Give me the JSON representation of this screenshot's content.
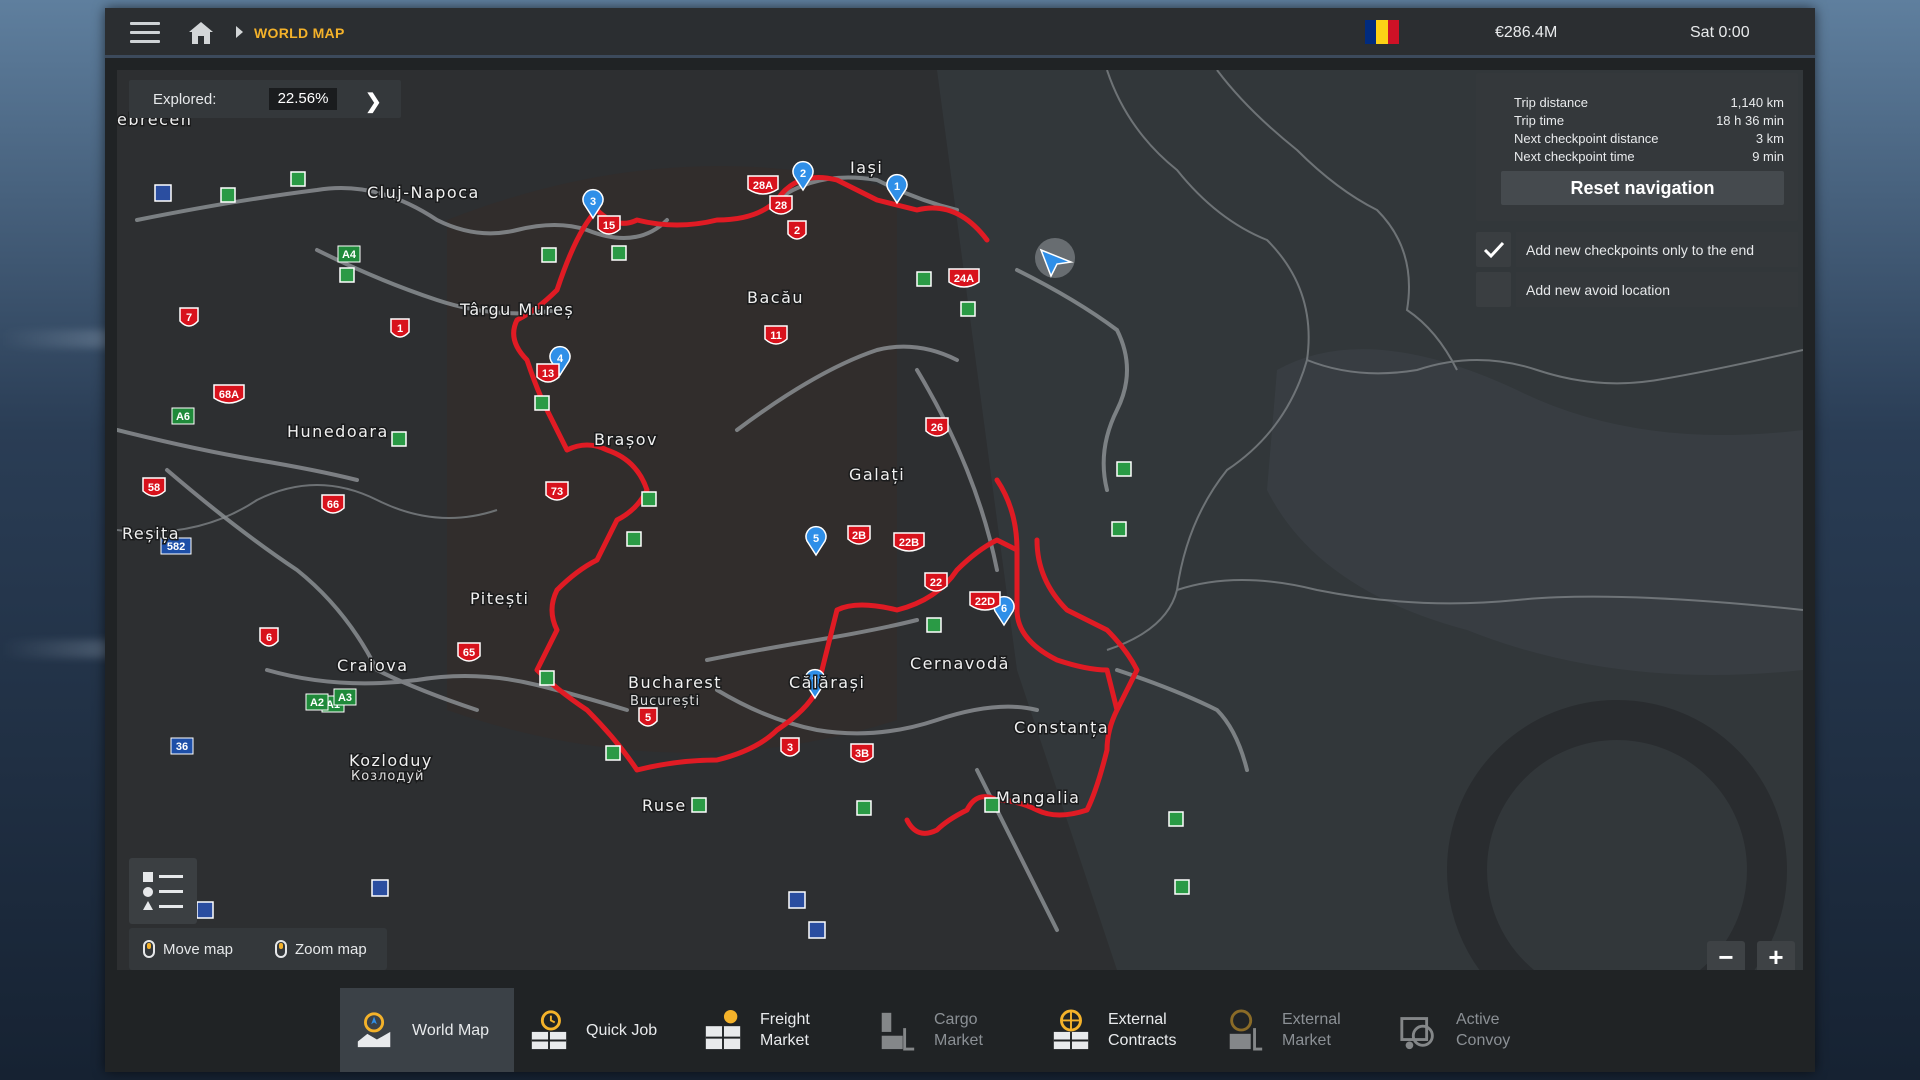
{
  "topbar": {
    "breadcrumb": "WORLD MAP",
    "money": "€286.4M",
    "time": "Sat 0:00",
    "flag_colors": [
      "#002b7f",
      "#fcd116",
      "#ce1126"
    ]
  },
  "map": {
    "explored_label": "Explored:",
    "explored_value": "22.56%",
    "cities": [
      {
        "name": "ebrecen"
      },
      {
        "name": "Cluj-Napoca"
      },
      {
        "name": "Iași"
      },
      {
        "name": "Târgu Mureș"
      },
      {
        "name": "Bacău"
      },
      {
        "name": "Hunedoara"
      },
      {
        "name": "Brașov"
      },
      {
        "name": "Galați"
      },
      {
        "name": "Reșița"
      },
      {
        "name": "Pitești"
      },
      {
        "name": "Craiova"
      },
      {
        "name": "Bucharest"
      },
      {
        "name": "Călărași"
      },
      {
        "name": "Cernavodă"
      },
      {
        "name": "Constanța"
      },
      {
        "name": "Kozloduy"
      },
      {
        "name": "Mangalia"
      },
      {
        "name": "Ruse"
      }
    ],
    "city_subtitles": {
      "bucharest": "București",
      "kozloduy": "Козлодуй"
    },
    "route_color": "#e01b24",
    "checkpoints": [
      "1",
      "2",
      "3",
      "4",
      "5",
      "6",
      "7"
    ],
    "road_numbers": [
      "28A",
      "28",
      "2",
      "15",
      "24A",
      "11",
      "13",
      "73",
      "26",
      "2B",
      "22B",
      "22",
      "22D",
      "5",
      "3",
      "3B",
      "7",
      "1",
      "68A",
      "58",
      "66",
      "6",
      "65",
      "A1",
      "A2",
      "A3",
      "A4",
      "A6",
      "582",
      "36"
    ]
  },
  "trip": {
    "rows": [
      {
        "label": "Trip distance",
        "value": "1,140 km"
      },
      {
        "label": "Trip time",
        "value": "18 h 36 min"
      },
      {
        "label": "Next checkpoint distance",
        "value": "3 km"
      },
      {
        "label": "Next checkpoint time",
        "value": "9 min"
      }
    ],
    "reset_label": "Reset navigation"
  },
  "options": {
    "checkpoints_end": {
      "label": "Add new checkpoints only to the end",
      "checked": true
    },
    "avoid_location": {
      "label": "Add new avoid location",
      "checked": false
    }
  },
  "hints": {
    "move": "Move map",
    "zoom": "Zoom map"
  },
  "zoom": {
    "minus": "−",
    "plus": "+"
  },
  "tabs": [
    {
      "label": "World Map",
      "icon": "world-map-icon",
      "active": true
    },
    {
      "label": "Quick Job",
      "icon": "quick-job-icon"
    },
    {
      "label": "Freight\nMarket",
      "icon": "freight-market-icon"
    },
    {
      "label": "Cargo\nMarket",
      "icon": "cargo-market-icon",
      "dim": true
    },
    {
      "label": "External\nContracts",
      "icon": "external-contracts-icon"
    },
    {
      "label": "External\nMarket",
      "icon": "external-market-icon",
      "dim": true
    },
    {
      "label": "Active\nConvoy",
      "icon": "active-convoy-icon",
      "dim": true
    }
  ]
}
